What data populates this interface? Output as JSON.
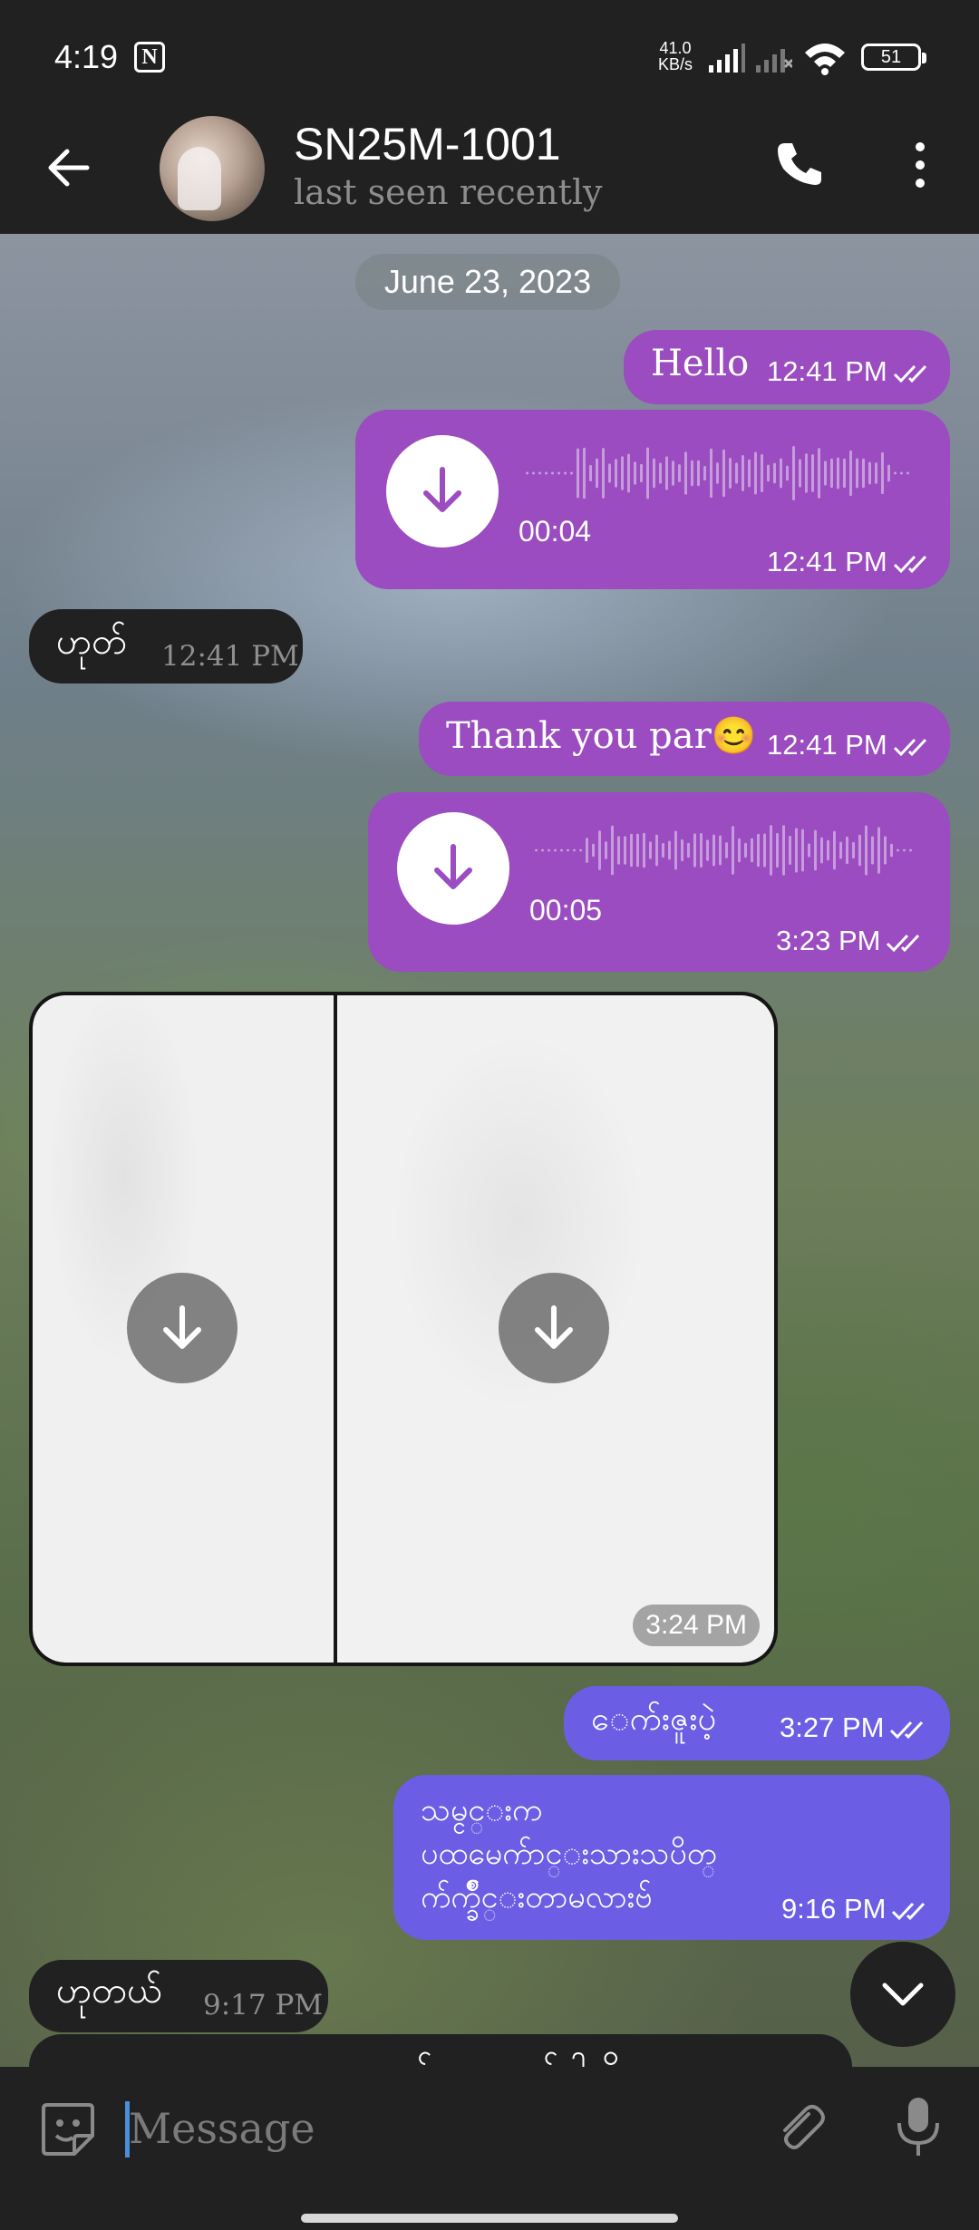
{
  "status_bar": {
    "time": "4:19",
    "net_speed_value": "41.0",
    "net_speed_unit": "KB/s",
    "battery": "51",
    "icons": [
      "notion-icon",
      "signal-icon",
      "signal-icon",
      "wifi-icon",
      "battery-icon"
    ]
  },
  "header": {
    "contact_name": "SN25M-1001",
    "contact_status": "last seen recently",
    "icons": [
      "back-arrow-icon",
      "phone-icon",
      "more-vertical-icon"
    ]
  },
  "chat": {
    "date_separator": "June 23, 2023",
    "messages": [
      {
        "direction": "out",
        "type": "text",
        "text": "Hello",
        "time": "12:41 PM",
        "read": true
      },
      {
        "direction": "out",
        "type": "voice",
        "duration": "00:04",
        "time": "12:41 PM",
        "read": true
      },
      {
        "direction": "in",
        "type": "text",
        "text": "ဟုတ်",
        "time": "12:41 PM"
      },
      {
        "direction": "out",
        "type": "text",
        "text": "Thank you par😊",
        "time": "12:41 PM",
        "read": true
      },
      {
        "direction": "out",
        "type": "voice",
        "duration": "00:05",
        "time": "3:23 PM",
        "read": true
      },
      {
        "direction": "in",
        "type": "album",
        "photo_count": 2,
        "time": "3:24 PM"
      },
      {
        "direction": "out",
        "type": "text",
        "text": "ေက်းဇူးပဲ့",
        "time": "3:27 PM",
        "read": true
      },
      {
        "direction": "out",
        "type": "text",
        "lines": [
          "သမ္ငင္းက",
          "ပထမေက်ာင္းသားသပိတ္",
          "က်က္ခ်ိဳင္းတာမလားဗ်"
        ],
        "time": "9:16 PM",
        "read": true
      },
      {
        "direction": "in",
        "type": "text",
        "text": "ဟုတယ်",
        "time": "9:17 PM"
      },
      {
        "direction": "in",
        "type": "text",
        "text": "ကလေးမှာသူ့ကလေးအတွက်ပေးရမယ်ပါလို့ကော"
      }
    ]
  },
  "input": {
    "placeholder": "Message",
    "icons": [
      "sticker-icon",
      "attach-icon",
      "mic-icon"
    ]
  },
  "colors": {
    "outgoing_bubble": "#9a4cc0",
    "outgoing_bubble_alt": "#6b5ee4",
    "incoming_bubble": "#212121",
    "bar_background": "#212121"
  }
}
